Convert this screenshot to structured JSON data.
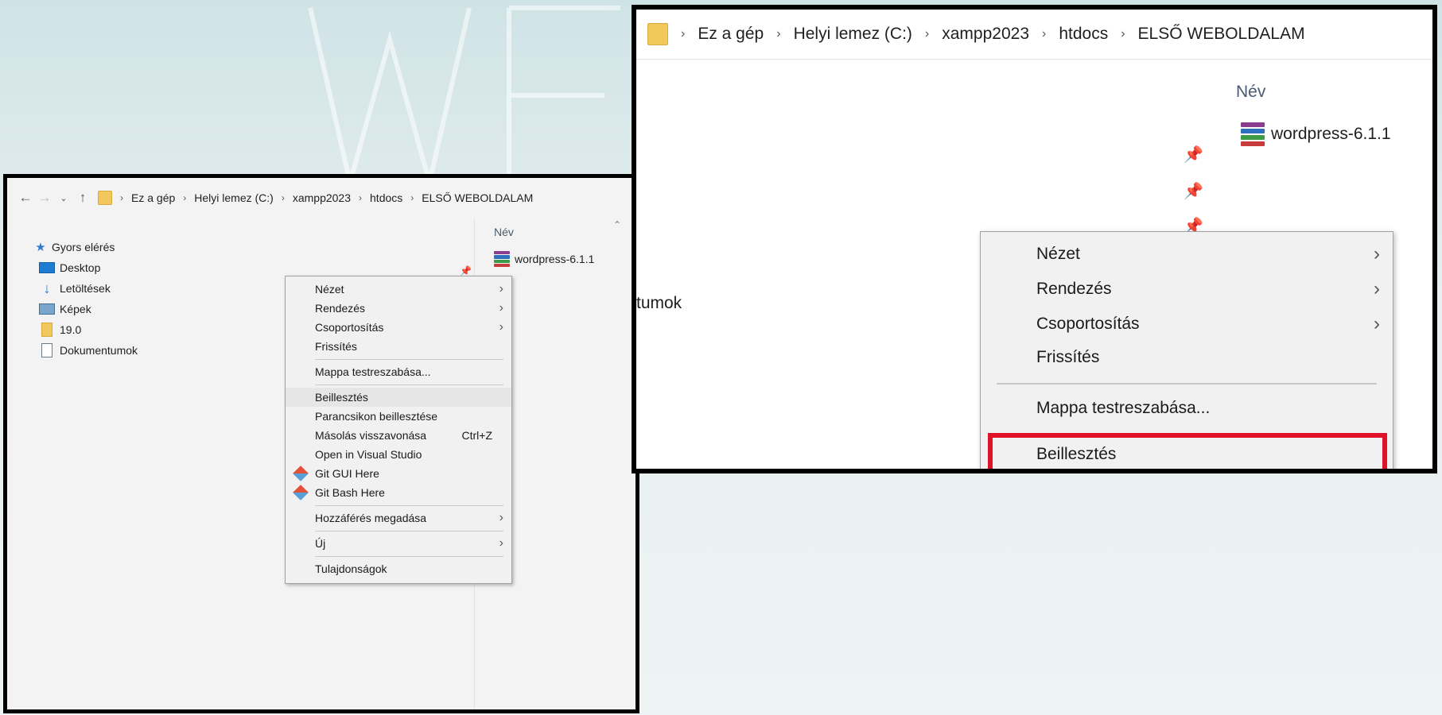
{
  "breadcrumb": [
    "Ez a gép",
    "Helyi lemez (C:)",
    "xampp2023",
    "htdocs",
    "ELSŐ WEBOLDALAM"
  ],
  "list": {
    "column_header": "Név",
    "files": [
      {
        "name": "wordpress-6.1.1",
        "icon": "winrar-archive-icon"
      }
    ]
  },
  "sidebar": {
    "quick_access": "Gyors elérés",
    "items": [
      {
        "label": "Desktop",
        "icon": "desktop-icon"
      },
      {
        "label": "Letöltések",
        "icon": "download-icon"
      },
      {
        "label": "Képek",
        "icon": "pictures-icon"
      },
      {
        "label": "19.0",
        "icon": "folder-icon"
      },
      {
        "label": "Dokumentumok",
        "icon": "document-icon"
      }
    ]
  },
  "context_menu": {
    "items": [
      {
        "label": "Nézet",
        "submenu": true
      },
      {
        "label": "Rendezés",
        "submenu": true
      },
      {
        "label": "Csoportosítás",
        "submenu": true
      },
      {
        "label": "Frissítés"
      },
      {
        "label": "Mappa testreszabása..."
      },
      {
        "label": "Beillesztés",
        "highlighted": true
      },
      {
        "label": "Parancsikon beillesztése"
      },
      {
        "label": "Másolás visszavonása",
        "shortcut": "Ctrl+Z"
      },
      {
        "label": "Open in Visual Studio"
      },
      {
        "label": "Git GUI Here",
        "icon": "git-icon"
      },
      {
        "label": "Git Bash Here",
        "icon": "git-icon"
      },
      {
        "label": "Hozzáférés megadása",
        "submenu": true
      },
      {
        "label": "Új",
        "submenu": true
      },
      {
        "label": "Tulajdonságok"
      }
    ]
  },
  "zoom_view": {
    "cut_sidebar_text": "tumok",
    "highlight_color": "#e0122a"
  }
}
